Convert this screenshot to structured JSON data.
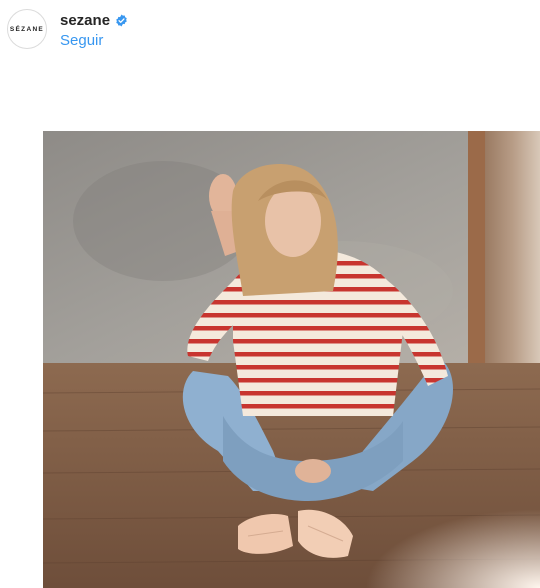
{
  "post": {
    "avatar_text": "SÉZANE",
    "username": "sezane",
    "verified": true,
    "follow_label": "Seguir"
  },
  "icons": {
    "verified": "verified-badge-icon"
  },
  "colors": {
    "link": "#3897f0",
    "verified": "#3897f0",
    "stripe_red": "#c8352f",
    "denim": "#8fb0d0"
  }
}
